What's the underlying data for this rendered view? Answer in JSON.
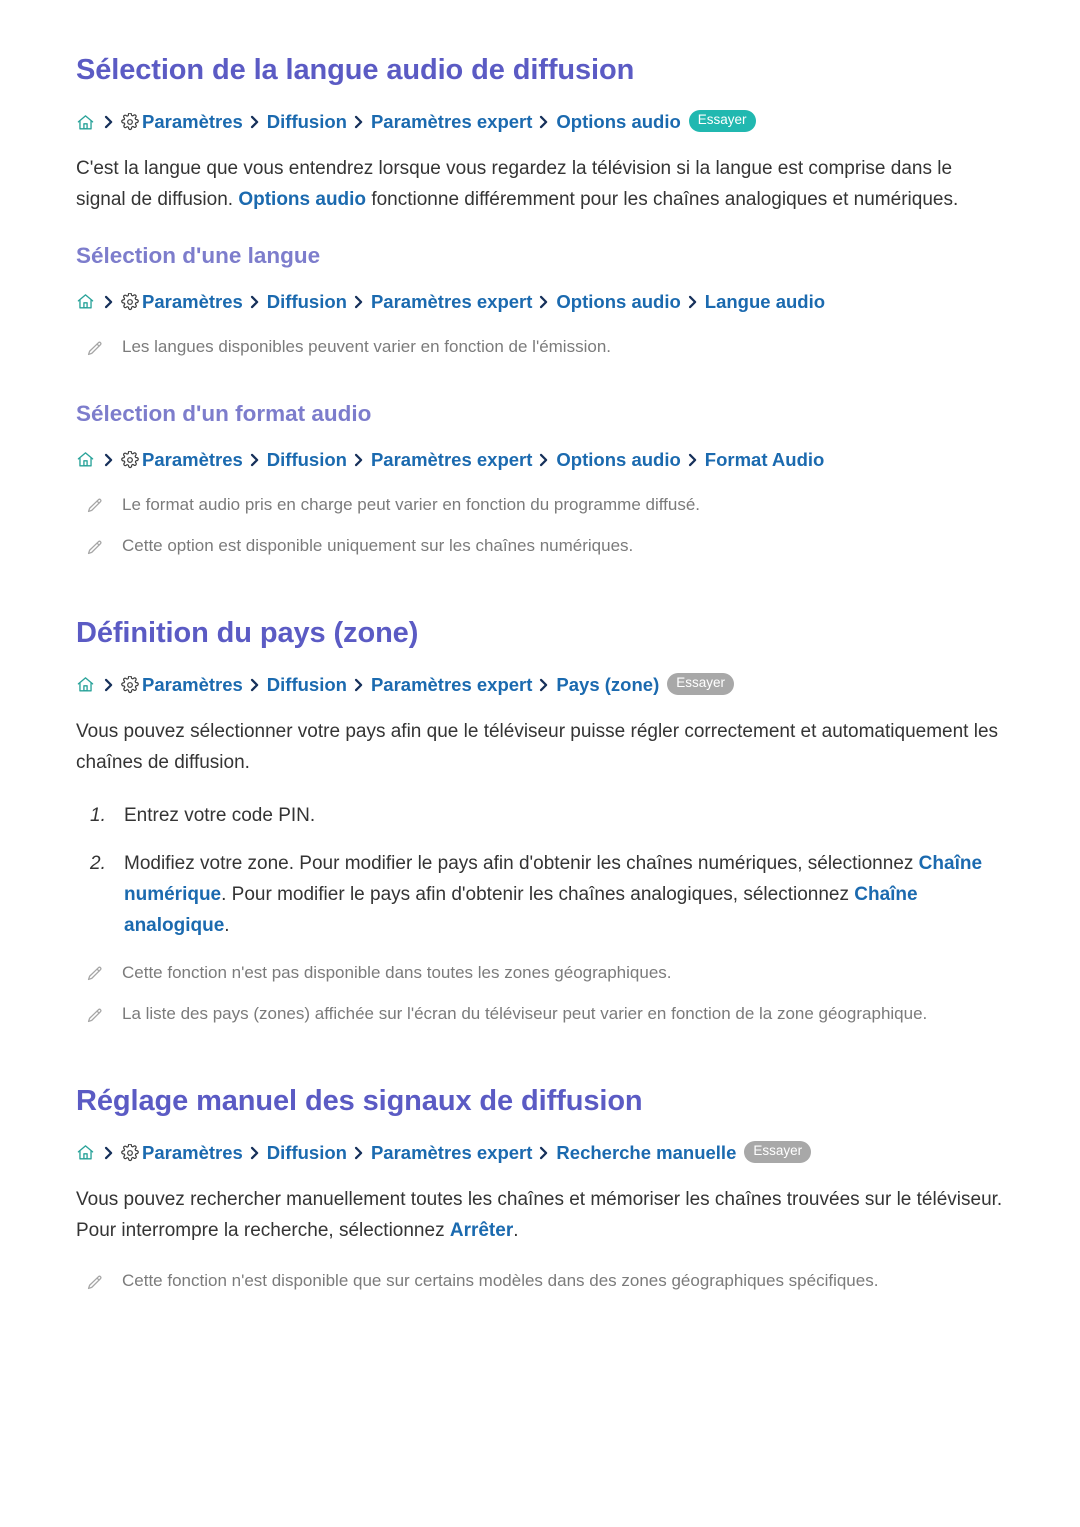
{
  "icons": {
    "home": "home-icon",
    "gear": "gear-icon",
    "separator": "chevron-right-icon",
    "note": "pencil-icon"
  },
  "colors": {
    "section_title": "#5b5bc4",
    "sub_title": "#7d7dcc",
    "link": "#1b6aaf",
    "badge_active": "#21b8b0",
    "badge_muted": "#a8a8a8",
    "body_text": "#343434",
    "note_text": "#7b7b7b",
    "separator": "#16305a",
    "background": "#ffffff"
  },
  "sections": [
    {
      "title": "Sélection de la langue audio de diffusion",
      "breadcrumb": {
        "items": [
          "Paramètres",
          "Diffusion",
          "Paramètres expert",
          "Options audio"
        ],
        "badge": "Essayer",
        "badge_state": "active"
      },
      "paragraph": {
        "part1": "C'est la langue que vous entendrez lorsque vous regardez la télévision si la langue est comprise dans le signal de diffusion. ",
        "link": "Options audio",
        "part2": " fonctionne différemment pour les chaînes analogiques et numériques."
      },
      "subsections": [
        {
          "title": "Sélection d'une langue",
          "breadcrumb": {
            "items": [
              "Paramètres",
              "Diffusion",
              "Paramètres expert",
              "Options audio",
              "Langue audio"
            ],
            "badge": null
          },
          "notes": [
            "Les langues disponibles peuvent varier en fonction de l'émission."
          ]
        },
        {
          "title": "Sélection d'un format audio",
          "breadcrumb": {
            "items": [
              "Paramètres",
              "Diffusion",
              "Paramètres expert",
              "Options audio",
              "Format Audio"
            ],
            "badge": null
          },
          "notes": [
            "Le format audio pris en charge peut varier en fonction du programme diffusé.",
            "Cette option est disponible uniquement sur les chaînes numériques."
          ]
        }
      ]
    },
    {
      "title": "Définition du pays (zone)",
      "breadcrumb": {
        "items": [
          "Paramètres",
          "Diffusion",
          "Paramètres expert",
          "Pays (zone)"
        ],
        "badge": "Essayer",
        "badge_state": "muted"
      },
      "paragraph": {
        "text": "Vous pouvez sélectionner votre pays afin que le téléviseur puisse régler correctement et automatiquement les chaînes de diffusion."
      },
      "steps": [
        {
          "num": "1.",
          "text": "Entrez votre code PIN."
        },
        {
          "num": "2.",
          "part1": "Modifiez votre zone. Pour modifier le pays afin d'obtenir les chaînes numériques, sélectionnez ",
          "link1": "Chaîne numérique",
          "part2": ". Pour modifier le pays afin d'obtenir les chaînes analogiques, sélectionnez ",
          "link2": "Chaîne analogique",
          "part3": "."
        }
      ],
      "notes": [
        "Cette fonction n'est pas disponible dans toutes les zones géographiques.",
        "La liste des pays (zones) affichée sur l'écran du téléviseur peut varier en fonction de la zone géographique."
      ]
    },
    {
      "title": "Réglage manuel des signaux de diffusion",
      "breadcrumb": {
        "items": [
          "Paramètres",
          "Diffusion",
          "Paramètres expert",
          "Recherche manuelle"
        ],
        "badge": "Essayer",
        "badge_state": "muted"
      },
      "paragraph": {
        "part1": "Vous pouvez rechercher manuellement toutes les chaînes et mémoriser les chaînes trouvées sur le téléviseur. Pour interrompre la recherche, sélectionnez ",
        "link": "Arrêter",
        "part2": "."
      },
      "notes": [
        "Cette fonction n'est disponible que sur certains modèles dans des zones géographiques spécifiques."
      ]
    }
  ]
}
